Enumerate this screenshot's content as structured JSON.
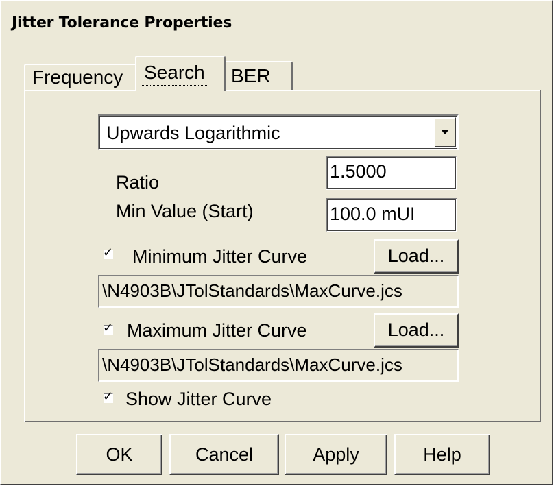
{
  "window": {
    "title": "Jitter Tolerance Properties"
  },
  "tabs": [
    {
      "label": "Frequency"
    },
    {
      "label": "Search",
      "active": true
    },
    {
      "label": "BER"
    }
  ],
  "search": {
    "mode": {
      "selected": "Upwards Logarithmic"
    },
    "ratio": {
      "label": "Ratio",
      "value": "1.5000"
    },
    "min_value": {
      "label": "Min Value (Start)",
      "value": "100.0 mUI"
    },
    "min_curve": {
      "checked": true,
      "label": "Minimum Jitter Curve",
      "load_label": "Load...",
      "path": "\\N4903B\\JTolStandards\\MaxCurve.jcs"
    },
    "max_curve": {
      "checked": true,
      "label": "Maximum Jitter Curve",
      "load_label": "Load...",
      "path": "\\N4903B\\JTolStandards\\MaxCurve.jcs"
    },
    "show_curve": {
      "checked": true,
      "label": "Show Jitter Curve"
    }
  },
  "buttons": {
    "ok": "OK",
    "cancel": "Cancel",
    "apply": "Apply",
    "help": "Help"
  },
  "colors": {
    "face": "#ece9d8",
    "highlight": "#ffffff",
    "shadow": "#808080",
    "dark_shadow": "#404040"
  }
}
